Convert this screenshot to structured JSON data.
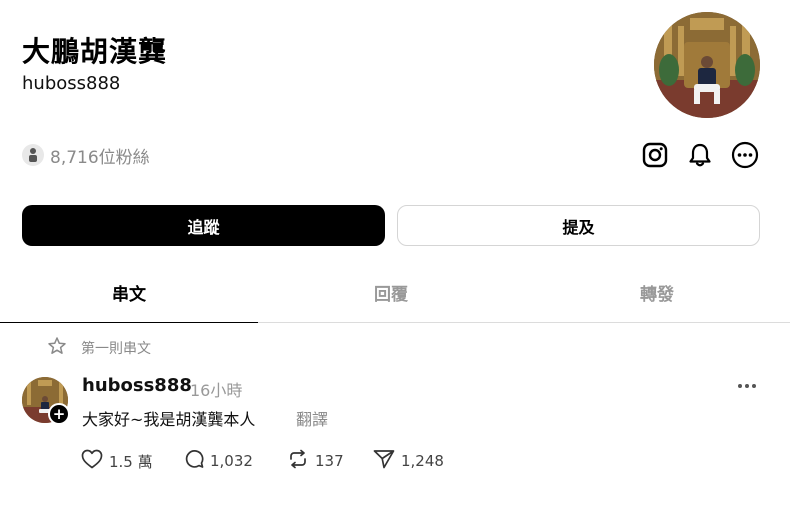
{
  "profile": {
    "display_name": "大鵬胡漢龔",
    "username": "huboss888",
    "followers": "8,716位粉絲"
  },
  "buttons": {
    "follow": "追蹤",
    "mention": "提及"
  },
  "tabs": [
    {
      "label": "串文",
      "active": true
    },
    {
      "label": "回覆",
      "active": false
    },
    {
      "label": "轉發",
      "active": false
    }
  ],
  "post": {
    "pinned_label": "第一則串文",
    "author": "huboss888",
    "time": "16小時",
    "text": "大家好~我是胡漢龔本人",
    "translate": "翻譯",
    "likes": "1.5 萬",
    "comments": "1,032",
    "reposts": "137",
    "shares": "1,248"
  },
  "icons": [
    "instagram-icon",
    "bell-icon",
    "more-options-icon",
    "star-icon",
    "heart-icon",
    "comment-icon",
    "repost-icon",
    "share-icon"
  ],
  "colors": {
    "primary_button": "#000000",
    "muted_text": "#8a8a8a",
    "divider": "#dcdcdc"
  }
}
